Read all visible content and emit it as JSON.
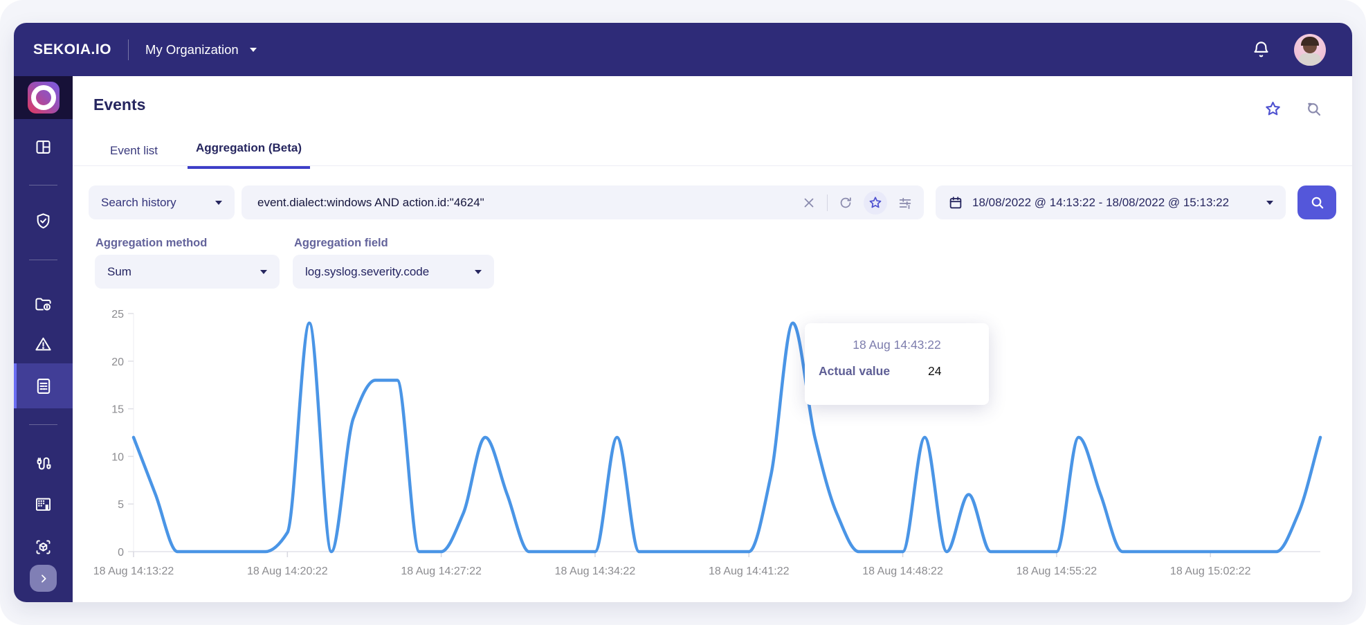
{
  "topbar": {
    "brand": "SEKOIA.IO",
    "org": "My Organization"
  },
  "sidebar": {
    "icons": [
      "sekoia-logo",
      "dashboard",
      "shield-check",
      "folder-alert",
      "warning-triangle",
      "event-list-active",
      "cable-intake",
      "building",
      "box-scan",
      "expand-chevron"
    ]
  },
  "header": {
    "title": "Events",
    "icons": [
      "star-icon",
      "search-history-icon"
    ]
  },
  "tabs": [
    {
      "label": "Event list",
      "active": false
    },
    {
      "label": "Aggregation (Beta)",
      "active": true
    }
  ],
  "search": {
    "history_label": "Search history",
    "query": "event.dialect:windows AND action.id:\"4624\"",
    "icons": [
      "clear-icon",
      "refresh-icon",
      "star-icon",
      "sliders-icon"
    ],
    "date_range": "18/08/2022 @ 14:13:22 - 18/08/2022 @ 15:13:22"
  },
  "aggregation": {
    "method_label": "Aggregation method",
    "method_value": "Sum",
    "field_label": "Aggregation field",
    "field_value": "log.syslog.severity.code"
  },
  "tooltip": {
    "title": "18 Aug 14:43:22",
    "label": "Actual value",
    "value": "24"
  },
  "chart_data": {
    "type": "line",
    "title": "",
    "xlabel": "",
    "ylabel": "",
    "ylim": [
      0,
      25
    ],
    "y_ticks": [
      0,
      5,
      10,
      15,
      20,
      25
    ],
    "grid": false,
    "legend": "none",
    "line_color": "#4a95e6",
    "axis_color": "#e2e2ea",
    "tick_text_color": "#8b8b8f",
    "x_tick_indices": [
      0,
      7,
      14,
      21,
      28,
      35,
      42,
      49
    ],
    "x_tick_labels": [
      "18 Aug 14:13:22",
      "18 Aug 14:20:22",
      "18 Aug 14:27:22",
      "18 Aug 14:34:22",
      "18 Aug 14:41:22",
      "18 Aug 14:48:22",
      "18 Aug 14:55:22",
      "18 Aug 15:02:22"
    ],
    "points": [
      {
        "t": "18 Aug 14:13:22",
        "v": 12
      },
      {
        "t": "18 Aug 14:14:22",
        "v": 6
      },
      {
        "t": "18 Aug 14:15:22",
        "v": 0
      },
      {
        "t": "18 Aug 14:16:22",
        "v": 0
      },
      {
        "t": "18 Aug 14:17:22",
        "v": 0
      },
      {
        "t": "18 Aug 14:18:22",
        "v": 0
      },
      {
        "t": "18 Aug 14:19:22",
        "v": 0
      },
      {
        "t": "18 Aug 14:20:22",
        "v": 2
      },
      {
        "t": "18 Aug 14:21:22",
        "v": 24
      },
      {
        "t": "18 Aug 14:22:22",
        "v": 0
      },
      {
        "t": "18 Aug 14:23:22",
        "v": 14
      },
      {
        "t": "18 Aug 14:24:22",
        "v": 18
      },
      {
        "t": "18 Aug 14:25:22",
        "v": 18
      },
      {
        "t": "18 Aug 14:26:22",
        "v": 0
      },
      {
        "t": "18 Aug 14:27:22",
        "v": 0
      },
      {
        "t": "18 Aug 14:28:22",
        "v": 4
      },
      {
        "t": "18 Aug 14:29:22",
        "v": 12
      },
      {
        "t": "18 Aug 14:30:22",
        "v": 6
      },
      {
        "t": "18 Aug 14:31:22",
        "v": 0
      },
      {
        "t": "18 Aug 14:32:22",
        "v": 0
      },
      {
        "t": "18 Aug 14:33:22",
        "v": 0
      },
      {
        "t": "18 Aug 14:34:22",
        "v": 0
      },
      {
        "t": "18 Aug 14:35:22",
        "v": 12
      },
      {
        "t": "18 Aug 14:36:22",
        "v": 0
      },
      {
        "t": "18 Aug 14:37:22",
        "v": 0
      },
      {
        "t": "18 Aug 14:38:22",
        "v": 0
      },
      {
        "t": "18 Aug 14:39:22",
        "v": 0
      },
      {
        "t": "18 Aug 14:40:22",
        "v": 0
      },
      {
        "t": "18 Aug 14:41:22",
        "v": 0
      },
      {
        "t": "18 Aug 14:42:22",
        "v": 8
      },
      {
        "t": "18 Aug 14:43:22",
        "v": 24
      },
      {
        "t": "18 Aug 14:44:22",
        "v": 12
      },
      {
        "t": "18 Aug 14:45:22",
        "v": 4
      },
      {
        "t": "18 Aug 14:46:22",
        "v": 0
      },
      {
        "t": "18 Aug 14:47:22",
        "v": 0
      },
      {
        "t": "18 Aug 14:48:22",
        "v": 0
      },
      {
        "t": "18 Aug 14:49:22",
        "v": 12
      },
      {
        "t": "18 Aug 14:50:22",
        "v": 0
      },
      {
        "t": "18 Aug 14:51:22",
        "v": 6
      },
      {
        "t": "18 Aug 14:52:22",
        "v": 0
      },
      {
        "t": "18 Aug 14:53:22",
        "v": 0
      },
      {
        "t": "18 Aug 14:54:22",
        "v": 0
      },
      {
        "t": "18 Aug 14:55:22",
        "v": 0
      },
      {
        "t": "18 Aug 14:56:22",
        "v": 12
      },
      {
        "t": "18 Aug 14:57:22",
        "v": 6
      },
      {
        "t": "18 Aug 14:58:22",
        "v": 0
      },
      {
        "t": "18 Aug 14:59:22",
        "v": 0
      },
      {
        "t": "18 Aug 15:00:22",
        "v": 0
      },
      {
        "t": "18 Aug 15:01:22",
        "v": 0
      },
      {
        "t": "18 Aug 15:02:22",
        "v": 0
      },
      {
        "t": "18 Aug 15:03:22",
        "v": 0
      },
      {
        "t": "18 Aug 15:04:22",
        "v": 0
      },
      {
        "t": "18 Aug 15:05:22",
        "v": 0
      },
      {
        "t": "18 Aug 15:06:22",
        "v": 4
      },
      {
        "t": "18 Aug 15:07:22",
        "v": 12
      }
    ]
  }
}
